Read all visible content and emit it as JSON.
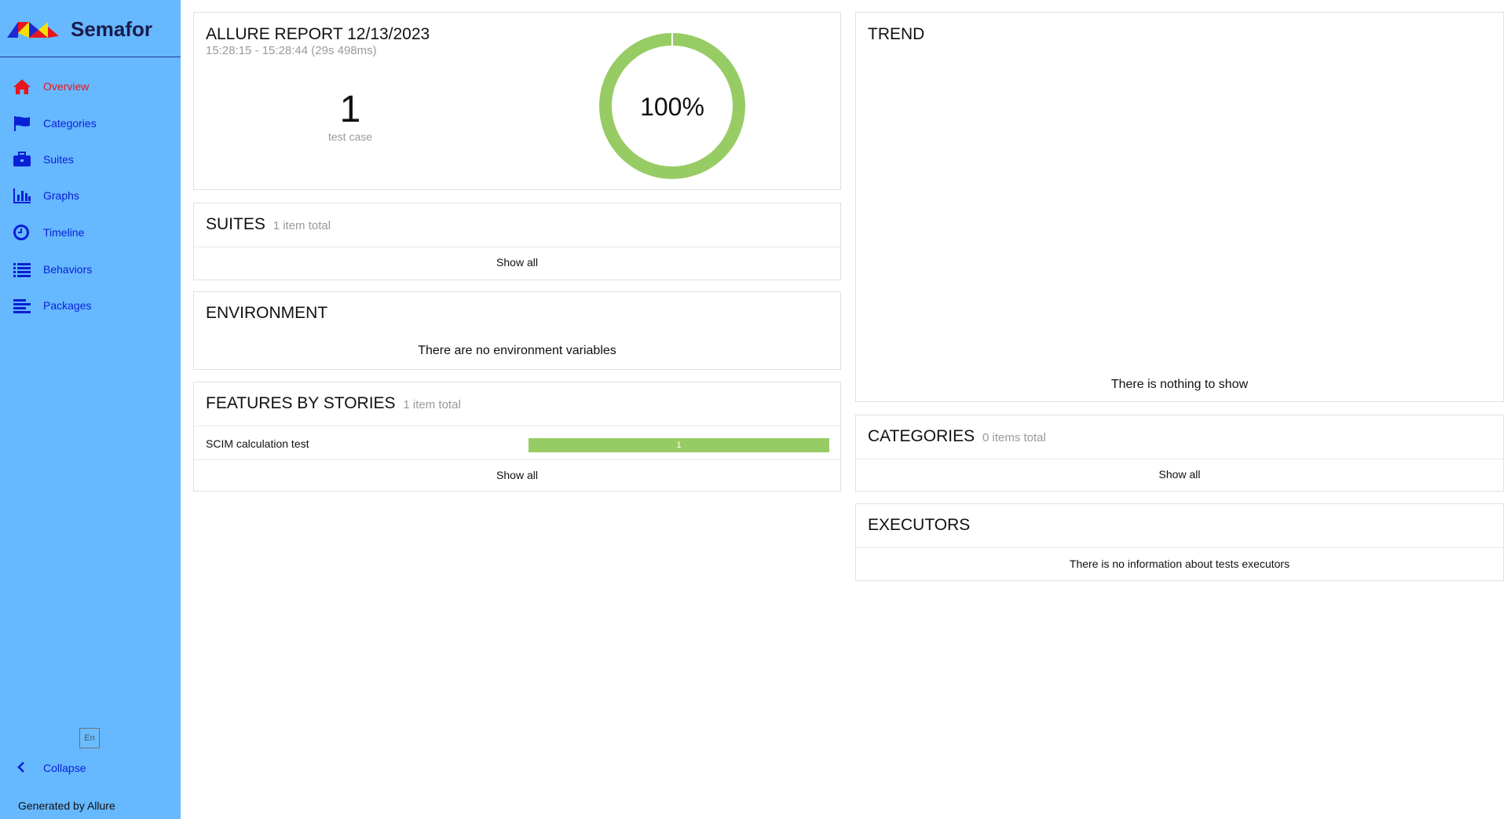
{
  "brand": {
    "name": "Semafor"
  },
  "sidebar": {
    "items": [
      {
        "label": "Overview",
        "icon": "home-icon",
        "active": true
      },
      {
        "label": "Categories",
        "icon": "flag-icon"
      },
      {
        "label": "Suites",
        "icon": "briefcase-icon"
      },
      {
        "label": "Graphs",
        "icon": "bar-chart-icon"
      },
      {
        "label": "Timeline",
        "icon": "clock-icon"
      },
      {
        "label": "Behaviors",
        "icon": "list-icon"
      },
      {
        "label": "Packages",
        "icon": "align-left-icon"
      }
    ],
    "language": "En",
    "collapse_label": "Collapse",
    "footer": "Generated by Allure"
  },
  "summary": {
    "title": "ALLURE REPORT 12/13/2023",
    "time_range": "15:28:15 - 15:28:44 (29s 498ms)",
    "test_count": "1",
    "test_count_label": "test case",
    "pass_percent_label": "100%",
    "pass_fraction": 1.0
  },
  "suites": {
    "title": "SUITES",
    "count_label": "1 item total",
    "show_all": "Show all"
  },
  "environment": {
    "title": "ENVIRONMENT",
    "empty_message": "There are no environment variables"
  },
  "features": {
    "title": "FEATURES BY STORIES",
    "count_label": "1 item total",
    "rows": [
      {
        "name": "SCIM calculation test",
        "passed": 1,
        "bar_label": "1"
      }
    ],
    "show_all": "Show all"
  },
  "trend": {
    "title": "TREND",
    "empty_message": "There is nothing to show"
  },
  "categories": {
    "title": "CATEGORIES",
    "count_label": "0 items total",
    "show_all": "Show all"
  },
  "executors": {
    "title": "EXECUTORS",
    "empty_message": "There is no information about tests executors"
  },
  "colors": {
    "sidebar_bg": "#66b8ff",
    "nav_text": "#0a1fd6",
    "active_text": "#e8141e",
    "passed": "#97cc64"
  }
}
